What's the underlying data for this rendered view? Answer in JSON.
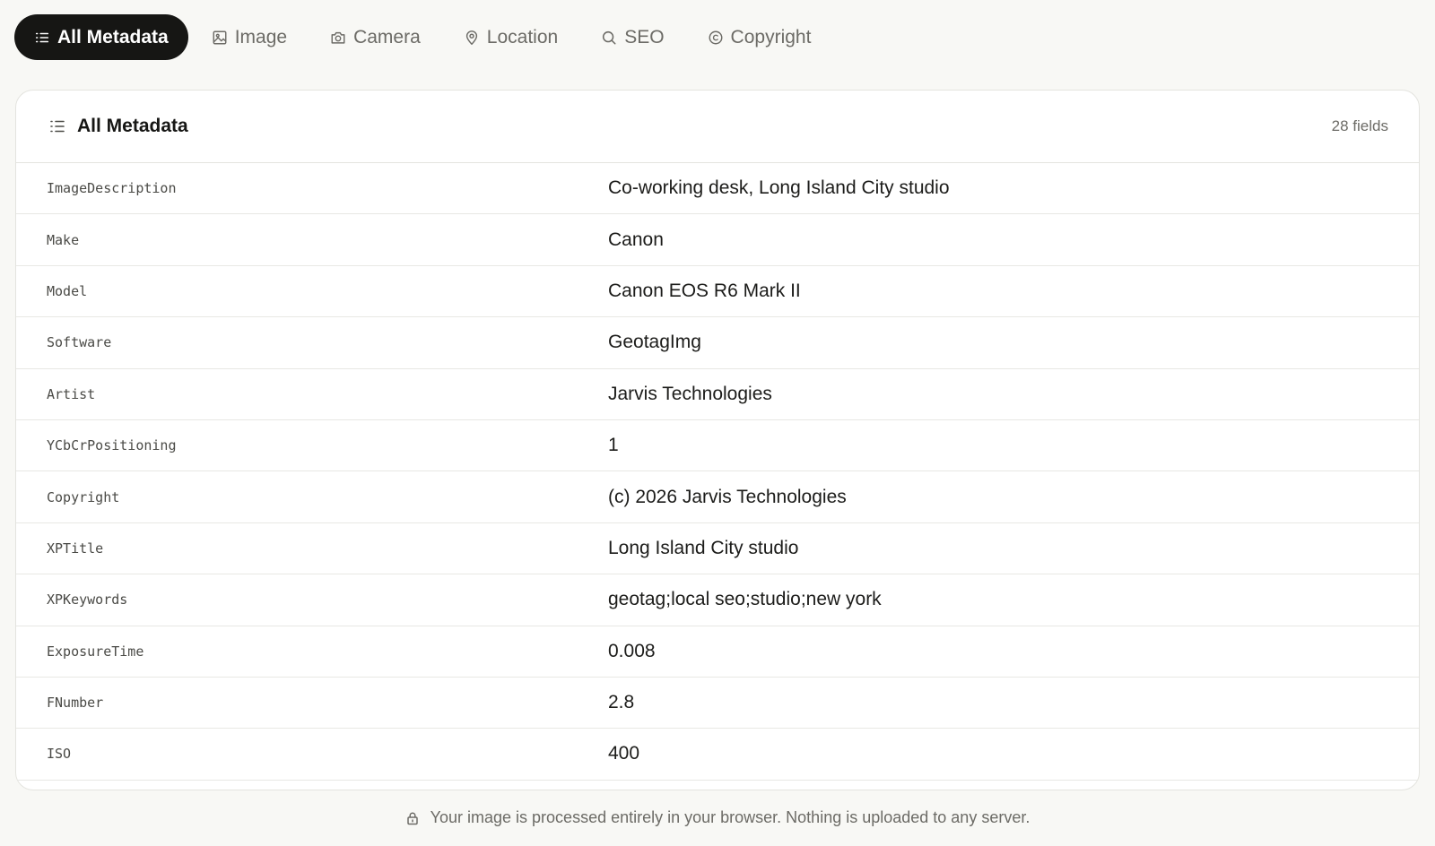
{
  "tabs": [
    {
      "label": "All Metadata",
      "icon": "list-icon",
      "active": true
    },
    {
      "label": "Image",
      "icon": "image-icon",
      "active": false
    },
    {
      "label": "Camera",
      "icon": "camera-icon",
      "active": false
    },
    {
      "label": "Location",
      "icon": "map-pin-icon",
      "active": false
    },
    {
      "label": "SEO",
      "icon": "search-icon",
      "active": false
    },
    {
      "label": "Copyright",
      "icon": "copyright-icon",
      "active": false
    }
  ],
  "panel": {
    "title": "All Metadata",
    "field_count": "28 fields",
    "rows": [
      {
        "key": "ImageDescription",
        "value": "Co-working desk, Long Island City studio"
      },
      {
        "key": "Make",
        "value": "Canon"
      },
      {
        "key": "Model",
        "value": "Canon EOS R6 Mark II"
      },
      {
        "key": "Software",
        "value": "GeotagImg"
      },
      {
        "key": "Artist",
        "value": "Jarvis Technologies"
      },
      {
        "key": "YCbCrPositioning",
        "value": "1"
      },
      {
        "key": "Copyright",
        "value": "(c) 2026 Jarvis Technologies"
      },
      {
        "key": "XPTitle",
        "value": "Long Island City studio"
      },
      {
        "key": "XPKeywords",
        "value": "geotag;local seo;studio;new york"
      },
      {
        "key": "ExposureTime",
        "value": "0.008"
      },
      {
        "key": "FNumber",
        "value": "2.8"
      },
      {
        "key": "ISO",
        "value": "400"
      }
    ]
  },
  "footer": {
    "text": "Your image is processed entirely in your browser. Nothing is uploaded to any server.",
    "icon": "lock-icon"
  },
  "colors": {
    "background": "#f8f8f5",
    "active_tab": "#161614",
    "muted_text": "#6c6b66",
    "border": "#e4e4df"
  }
}
